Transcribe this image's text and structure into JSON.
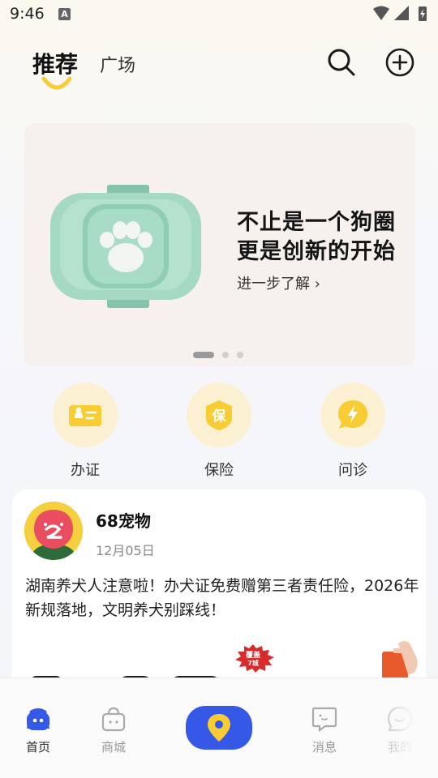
{
  "status_bar": {
    "time": "9:46",
    "notification_letter": "A"
  },
  "header": {
    "tabs": [
      {
        "label": "推荐",
        "active": true
      },
      {
        "label": "广场",
        "active": false
      }
    ],
    "icons": [
      "search-icon",
      "add-circle-icon"
    ]
  },
  "banner": {
    "line1": "不止是一个狗圈",
    "line2": "更是创新的开始",
    "more": "进一步了解 ›",
    "active_slide": 1,
    "slide_count": 3
  },
  "quick_actions": [
    {
      "label": "办证",
      "icon": "license-card-icon"
    },
    {
      "label": "保险",
      "icon": "insurance-shield-icon",
      "glyph": "保"
    },
    {
      "label": "问诊",
      "icon": "consult-chat-icon"
    }
  ],
  "post": {
    "author": "68宠物",
    "date": "12月05日",
    "text": "湖南养犬人注意啦！办犬证免费赠第三者责任险，2026年新规落地，文明养犬别踩线！",
    "sticker_line1": "覆盖",
    "sticker_line2": "7城"
  },
  "bottom_nav": {
    "items": [
      {
        "label": "首页",
        "icon": "home-icon",
        "active": true
      },
      {
        "label": "商城",
        "icon": "shop-bag-icon",
        "active": false
      },
      {
        "label": "消息",
        "icon": "message-icon",
        "active": false
      },
      {
        "label": "我的",
        "icon": "profile-icon",
        "active": false
      }
    ],
    "center_icon": "location-pin-icon"
  },
  "colors": {
    "accent_blue": "#3559e6",
    "accent_yellow": "#f7cd33",
    "icon_bg": "#fbf1d2"
  }
}
